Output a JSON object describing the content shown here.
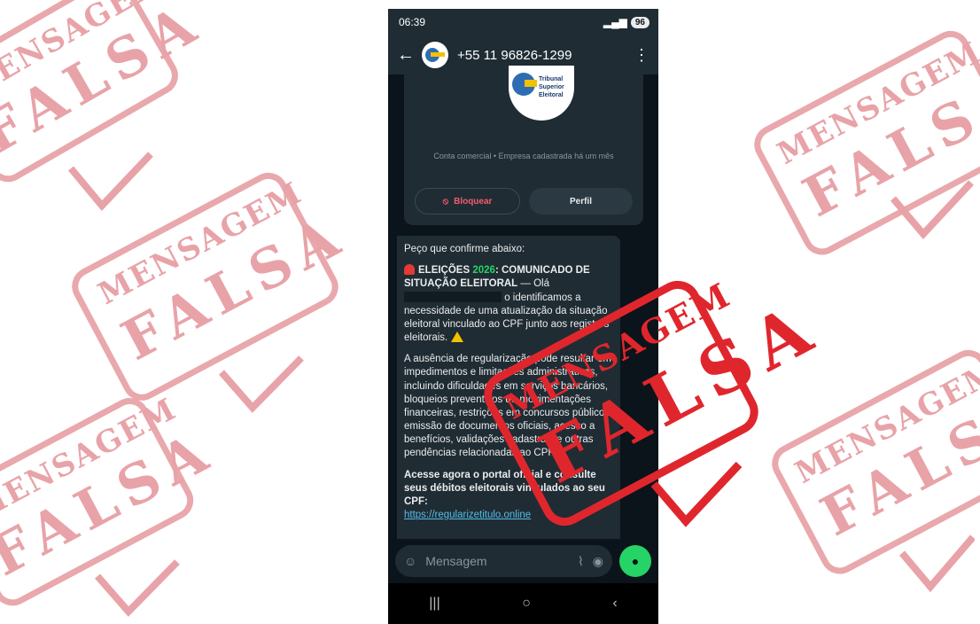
{
  "stamp": {
    "line1": "MENSAGEM",
    "line2": "FALSA",
    "faded_color": "#e8a3a8",
    "strong_color": "#e0262d"
  },
  "status_bar": {
    "time": "06:39",
    "battery": "96"
  },
  "header": {
    "back_icon": "arrow-left-icon",
    "contact": "+55 11 96826-1299",
    "menu_icon": "more-vertical-icon"
  },
  "business_card": {
    "logo_lines": [
      "Tribunal",
      "Superior",
      "Eleitoral"
    ],
    "info": "Conta comercial • Empresa cadastrada há um mês",
    "block_label": "Bloquear",
    "profile_label": "Perfil"
  },
  "message": {
    "intro": "Peço que confirme abaixo:",
    "headline_prefix": "ELEIÇÕES ",
    "headline_year": "2026",
    "headline_suffix": ": COMUNICADO DE SITUAÇÃO ELEITORAL",
    "greeting": " — Olá",
    "body1": "o identificamos a necessidade de uma atualização da situação eleitoral vinculado ao CPF junto aos registros eleitorais.",
    "body2": "A ausência de regularização pode resultar em impedimentos e limitações administrativas, incluindo dificuldades em serviços bancários, bloqueios preventivos de movimentações financeiras, restrições em concursos públicos, emissão de documentos oficiais, acesso a benefícios, validações cadastrais e outras pendências relacionadas ao CPF.",
    "cta": "Acesse agora o portal oficial e consulte seus débitos eleitorais vinculados ao seu CPF:",
    "link": "https://regularizetitulo.online"
  },
  "composer": {
    "placeholder": "Mensagem",
    "sticker_icon": "sticker-icon",
    "attach_icon": "paperclip-icon",
    "camera_icon": "camera-icon",
    "mic_icon": "microphone-icon"
  },
  "nav": {
    "recents": "|||",
    "home": "○",
    "back": "‹"
  },
  "accent": {
    "whatsapp_green": "#25d366",
    "link_blue": "#53bdeb"
  }
}
